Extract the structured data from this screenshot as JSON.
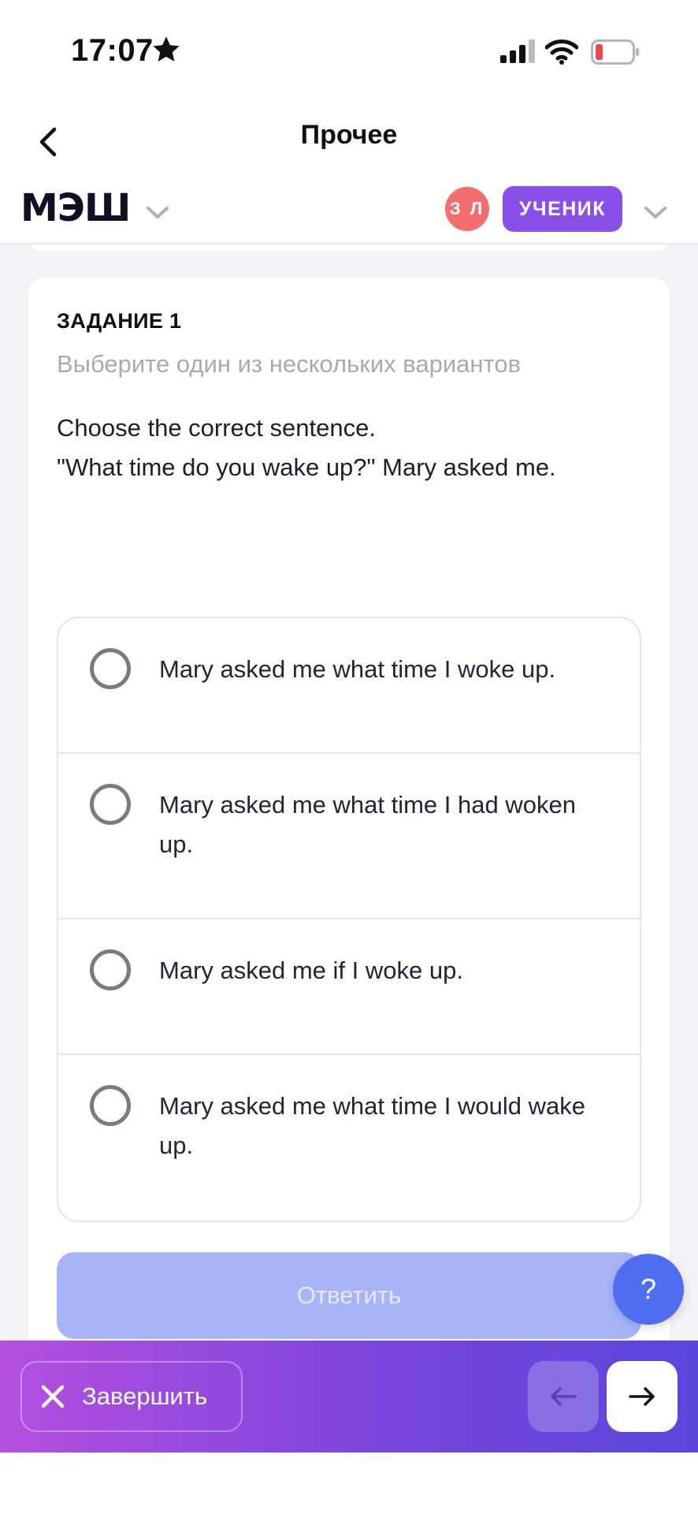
{
  "status_bar": {
    "time": "17:07",
    "icons": [
      "star-icon",
      "cellular-signal-icon",
      "wifi-icon",
      "battery-low-icon"
    ],
    "battery_color": "#f04848"
  },
  "nav": {
    "title": "Прочее",
    "back_icon": "chevron-left-icon"
  },
  "app_header": {
    "logo": "МЭШ",
    "avatar_initials": "З Л",
    "avatar_color": "#f26d6d",
    "role": "УЧЕНИК",
    "role_color": "#8a4fe8"
  },
  "task": {
    "number": "ЗАДАНИЕ 1",
    "hint": "Выберите один из нескольких вариантов",
    "question_line1": "Choose the correct sentence.",
    "question_line2": "\"What time do you wake up?\" Mary asked me.",
    "options": [
      {
        "label": "Mary asked me what time I woke up.",
        "selected": false
      },
      {
        "label": "Mary asked me what time I had woken up.",
        "selected": false
      },
      {
        "label": "Mary asked me if I woke up.",
        "selected": false
      },
      {
        "label": "Mary asked me what time I would wake up.",
        "selected": false
      }
    ],
    "answer_button": "Ответить",
    "answer_button_disabled": true
  },
  "help_button": "?",
  "bottom_bar": {
    "finish_label": "Завершить",
    "finish_icon": "close-icon",
    "prev_icon": "arrow-left-icon",
    "next_icon": "arrow-right-icon"
  }
}
